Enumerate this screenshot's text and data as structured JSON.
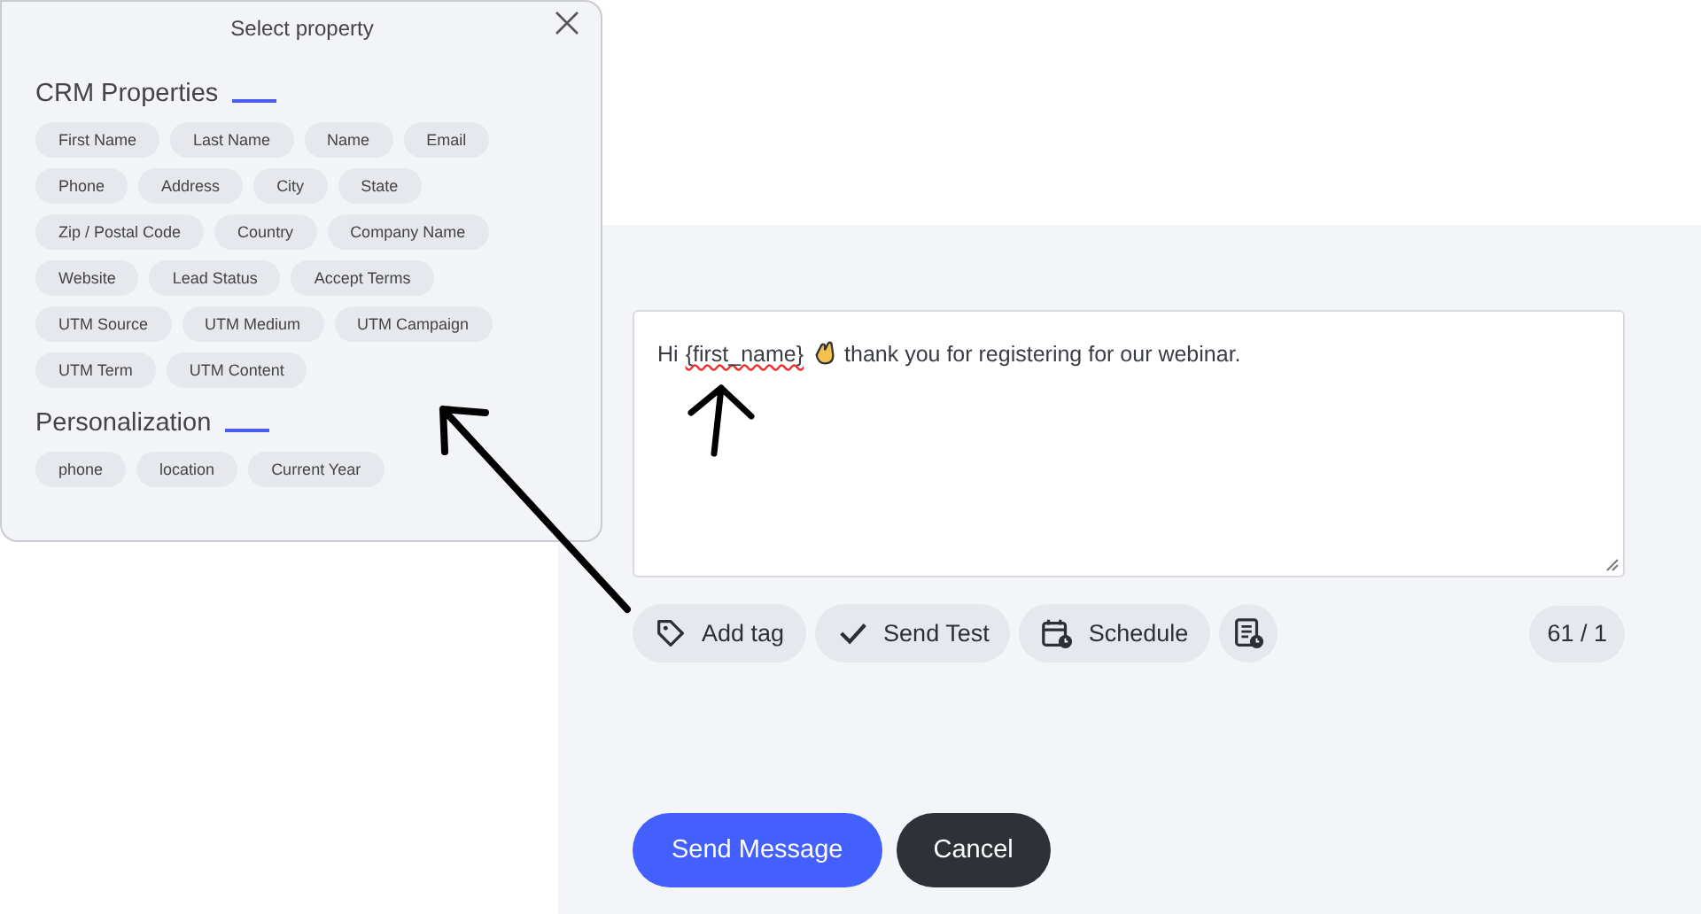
{
  "popup": {
    "title": "Select property",
    "sections": [
      {
        "heading": "CRM Properties",
        "chips": [
          "First Name",
          "Last Name",
          "Name",
          "Email",
          "Phone",
          "Address",
          "City",
          "State",
          "Zip / Postal Code",
          "Country",
          "Company Name",
          "Website",
          "Lead Status",
          "Accept Terms",
          "UTM Source",
          "UTM Medium",
          "UTM Campaign",
          "UTM Term",
          "UTM Content"
        ]
      },
      {
        "heading": "Personalization",
        "chips": [
          "phone",
          "location",
          "Current Year"
        ]
      }
    ]
  },
  "message": {
    "greeting": "Hi",
    "tag": "{first_name}",
    "rest": "thank you for registering for our webinar."
  },
  "toolbar": [
    {
      "kind": "tag",
      "label": "Add tag"
    },
    {
      "kind": "check",
      "label": "Send Test"
    },
    {
      "kind": "calendar",
      "label": "Schedule"
    },
    {
      "kind": "doc"
    }
  ],
  "counter": "61 / 1",
  "actions": [
    {
      "kind": "primary",
      "label": "Send Message"
    },
    {
      "kind": "dark",
      "label": "Cancel"
    }
  ]
}
